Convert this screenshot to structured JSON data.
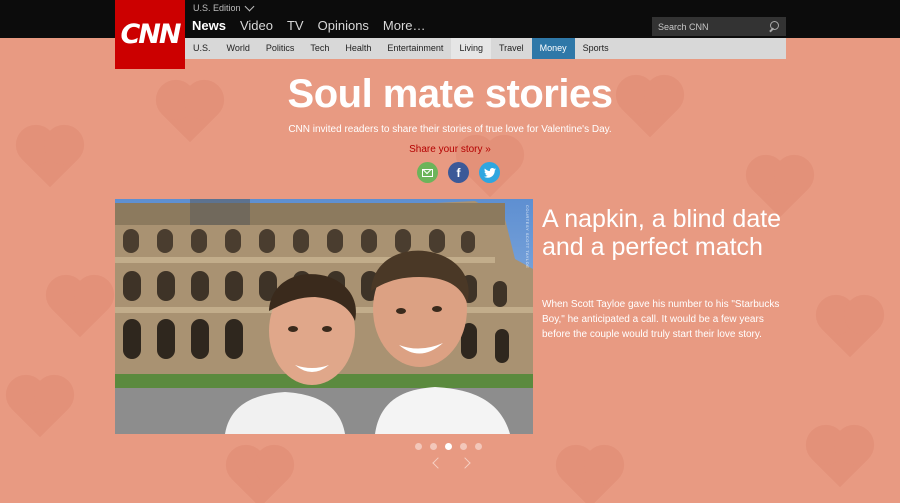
{
  "header": {
    "logo": "CNN",
    "edition": "U.S. Edition",
    "nav": [
      "News",
      "Video",
      "TV",
      "Opinions",
      "More…"
    ],
    "search_placeholder": "Search CNN"
  },
  "sections": [
    "U.S.",
    "World",
    "Politics",
    "Tech",
    "Health",
    "Entertainment",
    "Living",
    "Travel",
    "Money",
    "Sports"
  ],
  "hero": {
    "title": "Soul mate stories",
    "subtitle": "CNN invited readers to share their stories of true love for Valentine's Day.",
    "share_link": "Share your story »"
  },
  "social": [
    "email-icon",
    "facebook-icon",
    "twitter-icon"
  ],
  "story": {
    "title": "A napkin, a blind date and a perfect match",
    "description": "When Scott Tayloe gave his number to his \"Starbucks Boy,\" he anticipated a call. It would be a few years before the couple would truly start their love story.",
    "photo_credit": "COURTESY SCOTT TAYLOE"
  },
  "carousel": {
    "total": 5,
    "active": 3
  },
  "colors": {
    "cnn_red": "#cc0000",
    "money_blue": "#2f78a8",
    "background": "#e89a82",
    "share_red": "#b50000"
  }
}
